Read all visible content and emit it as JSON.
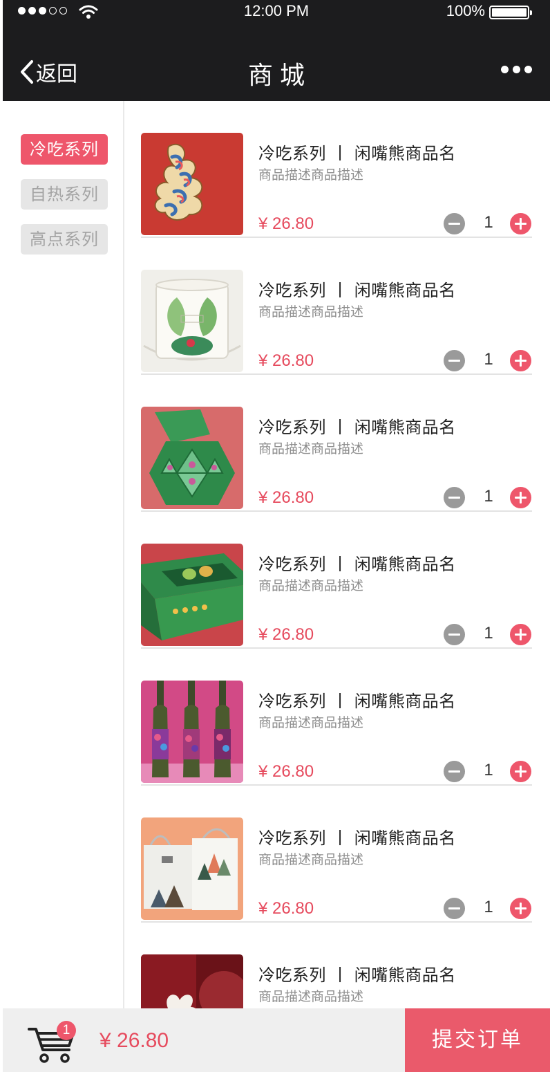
{
  "status_bar": {
    "time": "12:00 PM",
    "battery": "100%",
    "signal_icon": "signal-dots-icon",
    "wifi_icon": "wifi-icon",
    "battery_icon": "battery-icon"
  },
  "navbar": {
    "back_label": "返回",
    "title": "商城",
    "more_icon": "more-horizontal-icon"
  },
  "categories": [
    {
      "label": "冷吃系列",
      "active": true
    },
    {
      "label": "自热系列",
      "active": false
    },
    {
      "label": "高点系列",
      "active": false
    }
  ],
  "products": [
    {
      "name": "冷吃系列 丨 闲嘴熊商品名",
      "description": "商品描述商品描述",
      "price": "¥ 26.80",
      "quantity": "1",
      "image": "red cloud pattern gift card"
    },
    {
      "name": "冷吃系列 丨 闲嘴熊商品名",
      "description": "商品描述商品描述",
      "price": "¥ 26.80",
      "quantity": "1",
      "image": "white round gift box with green leaves"
    },
    {
      "name": "冷吃系列 丨 闲嘴熊商品名",
      "description": "商品描述商品描述",
      "price": "¥ 26.80",
      "quantity": "1",
      "image": "green hexagonal box on pink background"
    },
    {
      "name": "冷吃系列 丨 闲嘴熊商品名",
      "description": "商品描述商品描述",
      "price": "¥ 26.80",
      "quantity": "1",
      "image": "green kiwi fruit box on red background"
    },
    {
      "name": "冷吃系列 丨 闲嘴熊商品名",
      "description": "商品描述商品描述",
      "price": "¥ 26.80",
      "quantity": "1",
      "image": "three wine bottles with floral labels"
    },
    {
      "name": "冷吃系列 丨 闲嘴熊商品名",
      "description": "商品描述商品描述",
      "price": "¥ 26.80",
      "quantity": "1",
      "image": "two paper shopping bags on peach background"
    },
    {
      "name": "冷吃系列 丨 闲嘴熊商品名",
      "description": "商品描述商品描述",
      "price": "",
      "quantity": "",
      "image": "dark red packaging with flower"
    }
  ],
  "footer": {
    "cart_icon": "shopping-cart-icon",
    "cart_count": "1",
    "total": "¥ 26.80",
    "submit_label": "提交订单"
  },
  "colors": {
    "accent": "#ee566b",
    "price": "#e64b5e",
    "header_bg": "#1c1c1e"
  }
}
